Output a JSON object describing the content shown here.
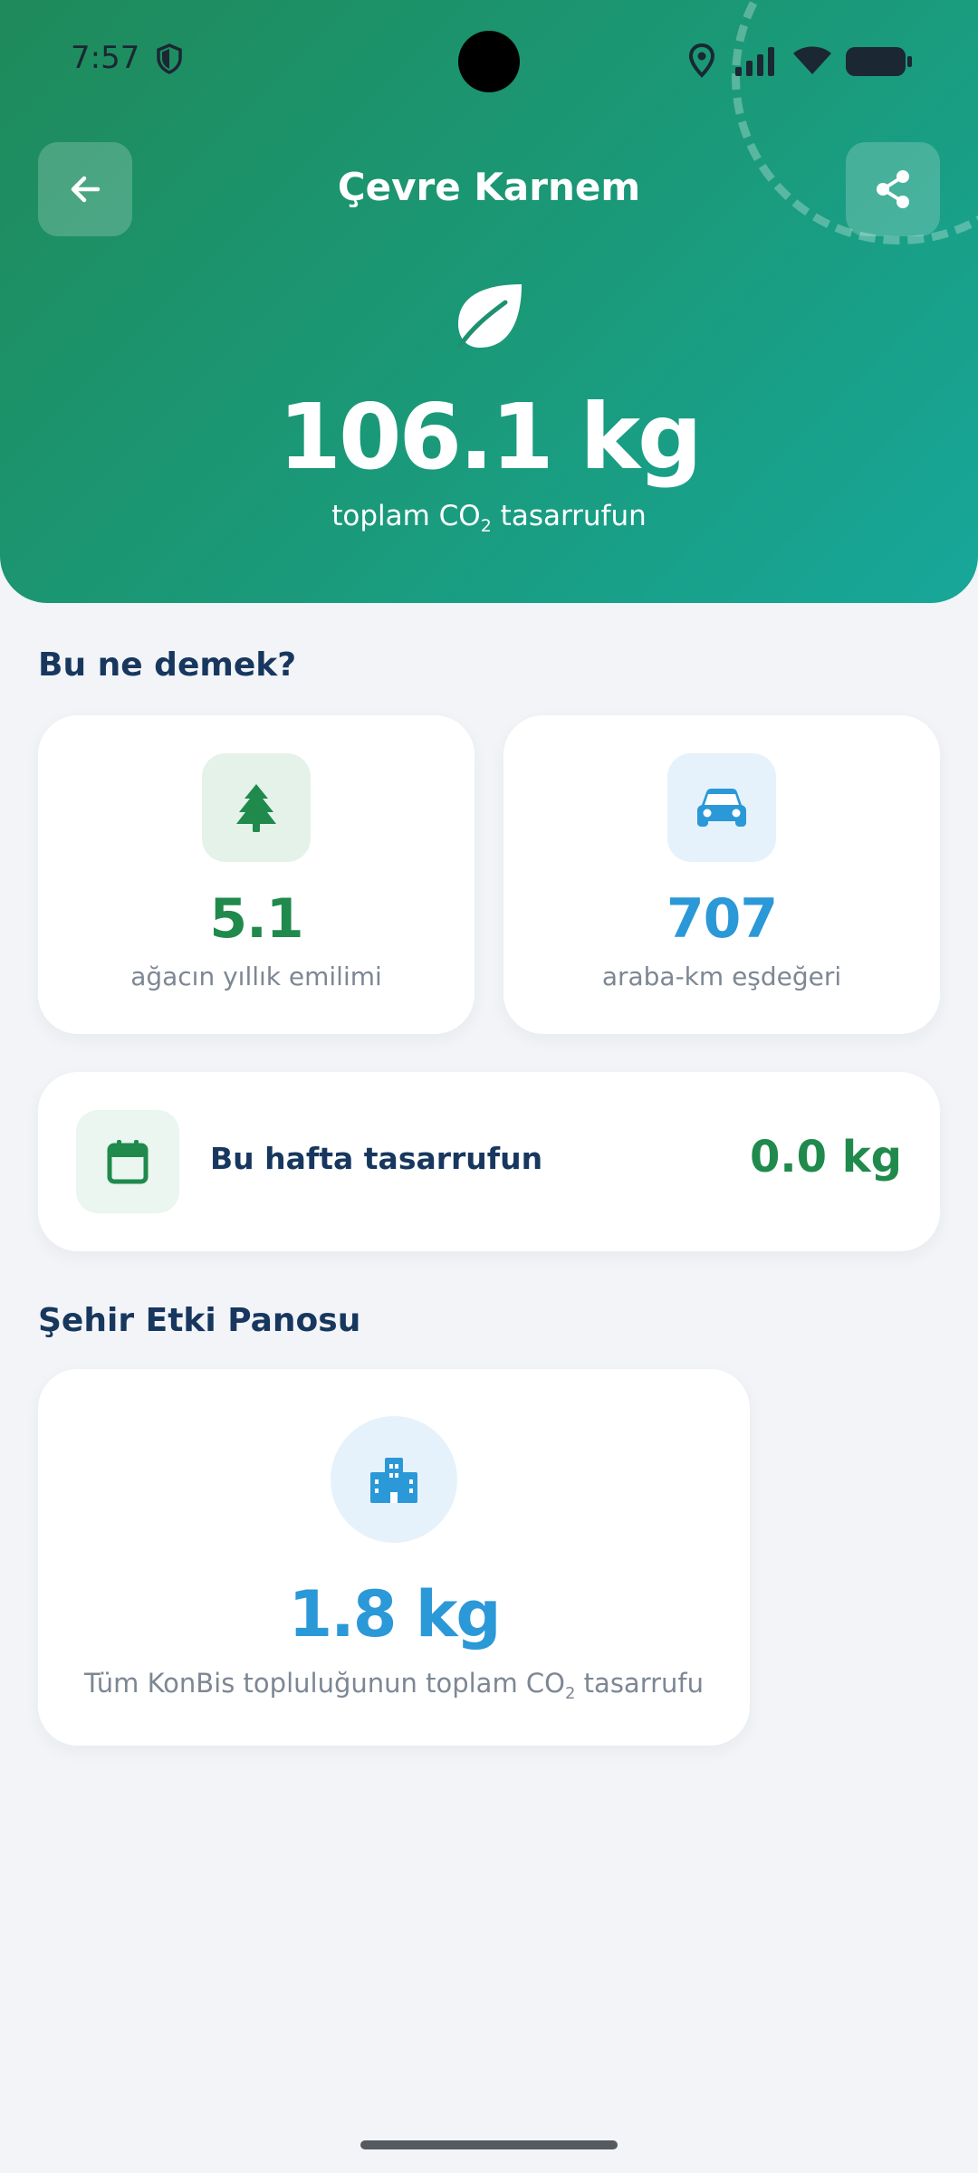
{
  "status_bar": {
    "time": "7:57"
  },
  "header": {
    "title": "Çevre Karnem",
    "total_value": "106.1 kg",
    "caption_prefix": "toplam CO",
    "caption_subscript": "2",
    "caption_suffix": " tasarrufun"
  },
  "meaning": {
    "section_title": "Bu ne demek?",
    "tree": {
      "value": "5.1",
      "label": "ağacın yıllık emilimi",
      "icon": "tree-icon"
    },
    "car": {
      "value": "707",
      "label": "araba-km eşdeğeri",
      "icon": "car-icon"
    }
  },
  "week": {
    "label": "Bu hafta tasarrufun",
    "value": "0.0 kg",
    "icon": "calendar-icon"
  },
  "city": {
    "section_title": "Şehir Etki Panosu",
    "value": "1.8 kg",
    "caption_prefix": "Tüm KonBis topluluğunun toplam CO",
    "caption_subscript": "2",
    "caption_suffix": " tasarrufu",
    "icon": "city-icon"
  },
  "colors": {
    "header_gradient_start": "#1f8a5a",
    "header_gradient_end": "#17a79a",
    "green_accent": "#1f8a4c",
    "blue_accent": "#2b98d8",
    "navy_text": "#17375e",
    "muted_text": "#7d8794",
    "background": "#f2f4f7"
  }
}
